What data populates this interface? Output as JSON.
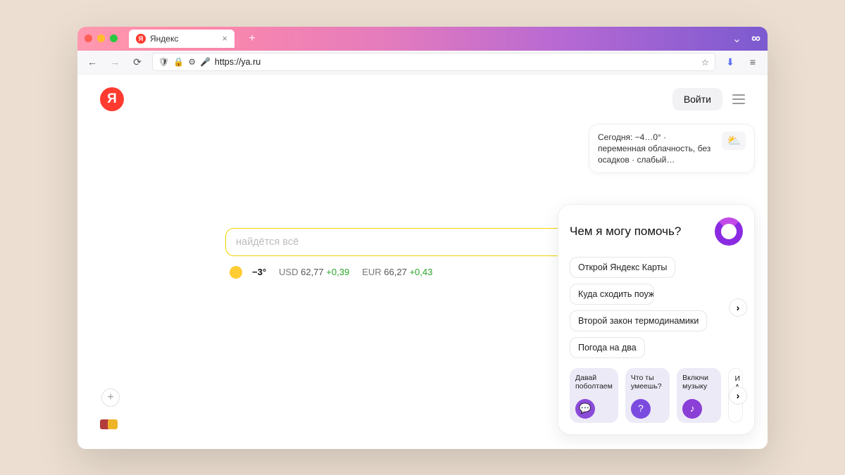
{
  "browser": {
    "tab": {
      "title": "Яндекс",
      "favicon_letter": "Я"
    },
    "url": "https://ya.ru"
  },
  "page": {
    "logo_letter": "Я",
    "login_label": "Войти"
  },
  "weather_card": {
    "text": "Сегодня: −4…0° · переменная облачность, без осадков · слабый…",
    "icon": "⛅"
  },
  "search": {
    "placeholder": "найдётся всё"
  },
  "info_row": {
    "temperature": "−3°",
    "currencies": [
      {
        "label": "USD",
        "value": "62,77",
        "delta": "+0,39"
      },
      {
        "label": "EUR",
        "value": "66,27",
        "delta": "+0,43"
      }
    ]
  },
  "alice": {
    "title": "Чем я могу помочь?",
    "chips": [
      "Открой Яндекс Карты",
      "Куда сходить поужина",
      "Второй закон термодинамики",
      "Погода на два"
    ],
    "cards": [
      {
        "label": "Давай поболтаем"
      },
      {
        "label": "Что ты умеешь?"
      },
      {
        "label": "Включи музыку"
      },
      {
        "label": "И А"
      }
    ]
  }
}
